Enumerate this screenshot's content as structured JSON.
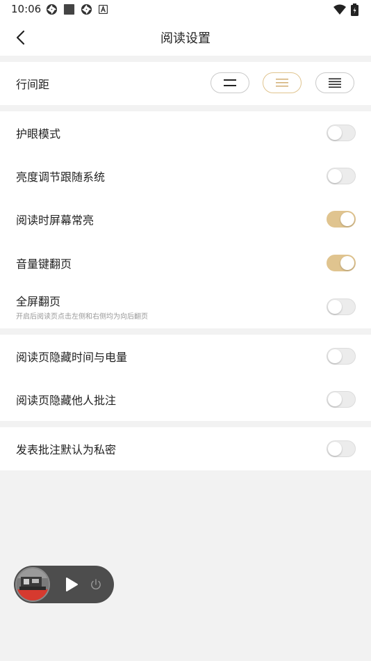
{
  "status_bar": {
    "time": "10:06",
    "icons": [
      "aperture-icon",
      "square-icon",
      "aperture-icon",
      "a-icon"
    ],
    "right_icons": [
      "wifi-icon",
      "battery-icon"
    ]
  },
  "header": {
    "title": "阅读设置",
    "back_icon": "chevron-left-icon"
  },
  "line_spacing": {
    "label": "行间距",
    "options": [
      "compact",
      "medium",
      "loose"
    ],
    "selected": "medium"
  },
  "settings": [
    {
      "label": "护眼模式",
      "on": false
    },
    {
      "label": "亮度调节跟随系统",
      "on": false
    },
    {
      "label": "阅读时屏幕常亮",
      "on": true
    },
    {
      "label": "音量键翻页",
      "on": true
    },
    {
      "label": "全屏翻页",
      "sub": "开启后阅读页点击左侧和右侧均为向后翻页",
      "on": false
    }
  ],
  "settings_group_2": [
    {
      "label": "阅读页隐藏时间与电量",
      "on": false
    },
    {
      "label": "阅读页隐藏他人批注",
      "on": false
    }
  ],
  "settings_group_3": [
    {
      "label": "发表批注默认为私密",
      "on": false
    }
  ],
  "colors": {
    "accent": "#e0c48f",
    "page_bg": "#f2f2f2",
    "card_bg": "#ffffff"
  },
  "mini_player": {
    "play_icon": "play-icon",
    "power_icon": "power-icon"
  }
}
